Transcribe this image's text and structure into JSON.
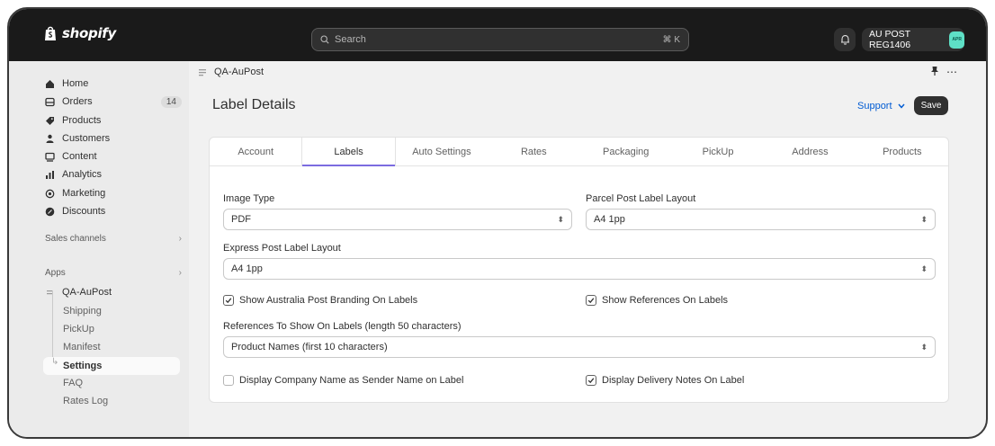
{
  "app": {
    "logo_text": "shopify"
  },
  "search": {
    "placeholder": "Search",
    "shortcut": "⌘ K"
  },
  "store": {
    "name": "AU POST REG1406",
    "avatar": "APR"
  },
  "sidebar": {
    "items": [
      {
        "label": "Home",
        "icon": "home-icon"
      },
      {
        "label": "Orders",
        "icon": "orders-icon",
        "count": "14"
      },
      {
        "label": "Products",
        "icon": "tag-icon"
      },
      {
        "label": "Customers",
        "icon": "person-icon"
      },
      {
        "label": "Content",
        "icon": "content-icon"
      },
      {
        "label": "Analytics",
        "icon": "bar-chart-icon"
      },
      {
        "label": "Marketing",
        "icon": "target-icon"
      },
      {
        "label": "Discounts",
        "icon": "discount-icon"
      }
    ],
    "sales_channels": "Sales channels",
    "apps": "Apps",
    "app_name": "QA-AuPost",
    "app_subitems": [
      "Shipping",
      "PickUp",
      "Manifest",
      "Settings",
      "FAQ",
      "Rates Log"
    ]
  },
  "breadcrumb": {
    "app": "QA-AuPost"
  },
  "page": {
    "title": "Label Details",
    "support": "Support",
    "save": "Save"
  },
  "tabs": [
    "Account",
    "Labels",
    "Auto Settings",
    "Rates",
    "Packaging",
    "PickUp",
    "Address",
    "Products"
  ],
  "active_tab": "Labels",
  "form": {
    "image_type": {
      "label": "Image Type",
      "value": "PDF"
    },
    "parcel_post": {
      "label": "Parcel Post Label Layout",
      "value": "A4 1pp"
    },
    "express_post": {
      "label": "Express Post Label Layout",
      "value": "A4 1pp"
    },
    "show_branding": {
      "label": "Show Australia Post Branding On Labels",
      "checked": true
    },
    "show_references": {
      "label": "Show References On Labels",
      "checked": true
    },
    "references": {
      "label": "References To Show On Labels (length 50 characters)",
      "value": "Product Names (first 10 characters)"
    },
    "company_name": {
      "label": "Display Company Name as Sender Name on Label",
      "checked": false
    },
    "delivery_notes": {
      "label": "Display Delivery Notes On Label",
      "checked": true
    }
  },
  "colors": {
    "accent": "#7b6be0",
    "topbar": "#1a1a1a",
    "link": "#005bd3",
    "avatar": "#5ee0c6"
  }
}
